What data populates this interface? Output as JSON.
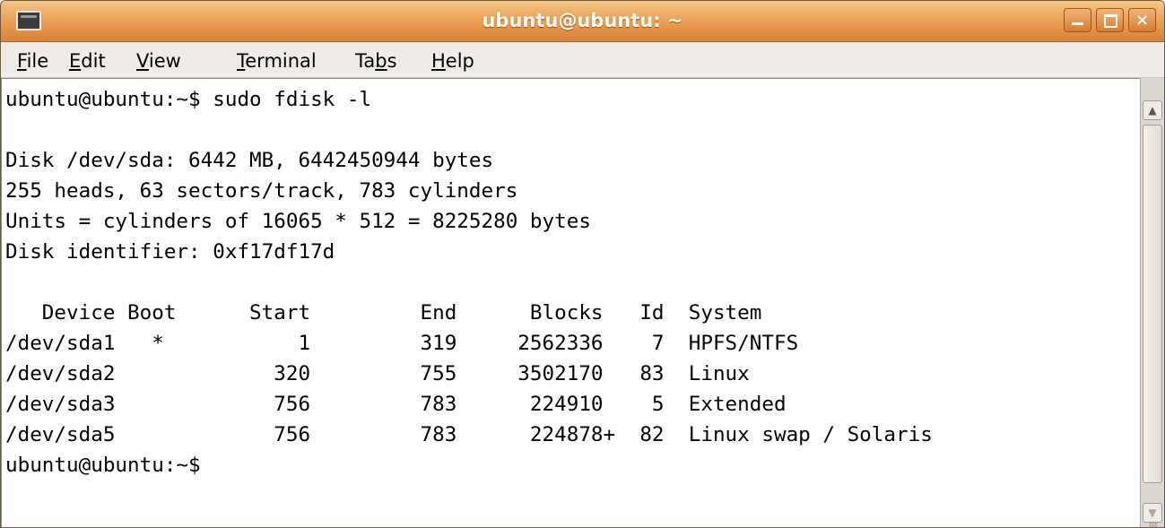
{
  "window": {
    "title": "ubuntu@ubuntu: ~",
    "buttons": {
      "minimize": "minimize",
      "maximize": "maximize",
      "close": "×"
    }
  },
  "menu": [
    {
      "label": "File",
      "mnemonic": "F"
    },
    {
      "label": "Edit",
      "mnemonic": "E"
    },
    {
      "label": "View",
      "mnemonic": "V"
    },
    {
      "label": "Terminal",
      "mnemonic": "T"
    },
    {
      "label": "Tabs",
      "mnemonic": "b"
    },
    {
      "label": "Help",
      "mnemonic": "H"
    }
  ],
  "terminal": {
    "lines": [
      "ubuntu@ubuntu:~$ sudo fdisk -l",
      "",
      "Disk /dev/sda: 6442 MB, 6442450944 bytes",
      "255 heads, 63 sectors/track, 783 cylinders",
      "Units = cylinders of 16065 * 512 = 8225280 bytes",
      "Disk identifier: 0xf17df17d",
      "",
      "   Device Boot      Start         End      Blocks   Id  System",
      "/dev/sda1   *           1         319     2562336    7  HPFS/NTFS",
      "/dev/sda2             320         755     3502170   83  Linux",
      "/dev/sda3             756         783      224910    5  Extended",
      "/dev/sda5             756         783      224878+  82  Linux swap / Solaris",
      "ubuntu@ubuntu:~$"
    ]
  },
  "colors": {
    "titlebar": "#eba356",
    "terminal_bg": "#ffffff",
    "terminal_fg": "#000000"
  }
}
